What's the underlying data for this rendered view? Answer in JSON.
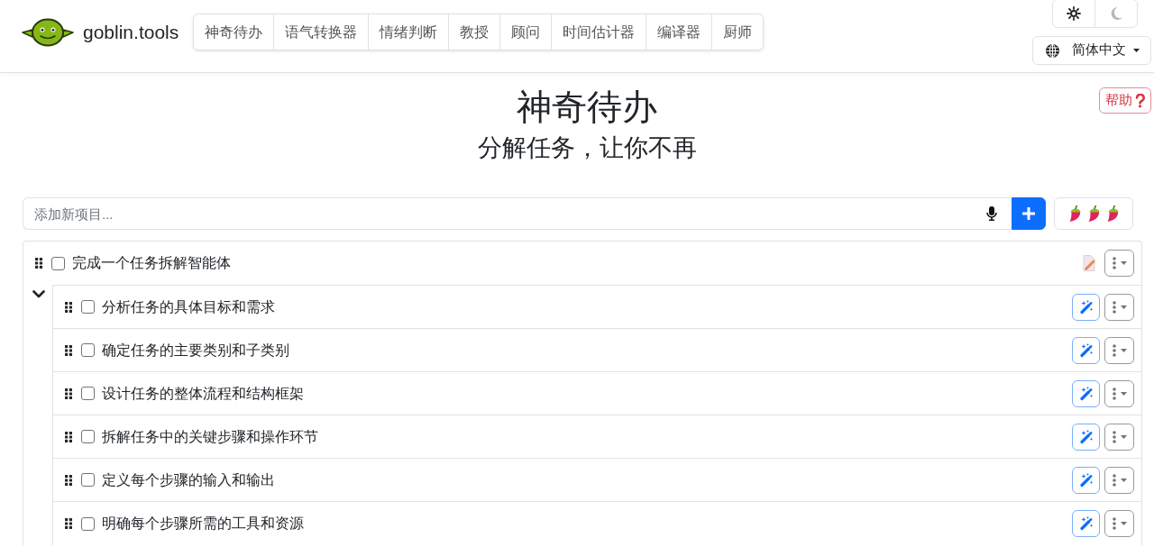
{
  "header": {
    "brand": "goblin.tools",
    "nav": [
      "神奇待办",
      "语气转换器",
      "情绪判断",
      "教授",
      "顾问",
      "时间估计器",
      "编译器",
      "厨师"
    ],
    "theme_buttons": [
      {
        "kind": "light",
        "selected": true
      },
      {
        "kind": "dark",
        "selected": false
      }
    ],
    "language": "简体中文"
  },
  "help_button": "帮助",
  "title": "神奇待办",
  "subtitle": "分解任务，让你不再",
  "new_item": {
    "placeholder": "添加新项目..."
  },
  "spicy_button": {
    "stars": 3
  },
  "tasks": [
    {
      "text": "完成一个任务拆解智能体",
      "checked": false,
      "expanded": true,
      "children": [
        {
          "text": "分析任务的具体目标和需求",
          "checked": false
        },
        {
          "text": "确定任务的主要类别和子类别",
          "checked": false
        },
        {
          "text": "设计任务的整体流程和结构框架",
          "checked": false
        },
        {
          "text": "拆解任务中的关键步骤和操作环节",
          "checked": false
        },
        {
          "text": "定义每个步骤的输入和输出",
          "checked": false
        },
        {
          "text": "明确每个步骤所需的工具和资源",
          "checked": false
        }
      ]
    }
  ]
}
